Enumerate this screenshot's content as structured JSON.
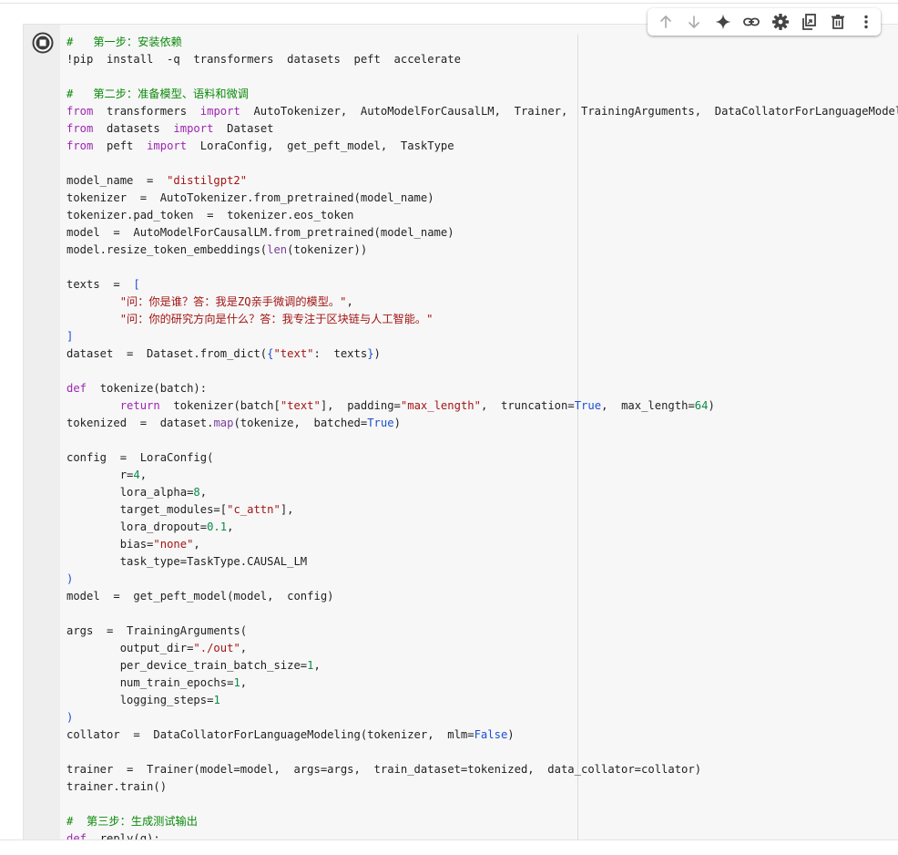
{
  "toolbar": {
    "icons": [
      "arrow-up-icon",
      "arrow-down-icon",
      "sparkle-icon",
      "link-icon",
      "gear-icon",
      "mirror-cell-icon",
      "trash-icon",
      "more-vert-icon"
    ]
  },
  "cell": {
    "run_icon": "run-cell-icon",
    "code_lines": [
      [
        [
          "cm",
          "#   第一步：安装依赖"
        ]
      ],
      [
        [
          "op",
          "!pip  install  -q  transformers  datasets  peft  accelerate"
        ]
      ],
      [],
      [
        [
          "cm",
          "#   第二步：准备模型、语料和微调"
        ]
      ],
      [
        [
          "kw",
          "from"
        ],
        [
          "op",
          "  transformers  "
        ],
        [
          "kw",
          "import"
        ],
        [
          "op",
          "  AutoTokenizer,  AutoModelForCausalLM,  Trainer,  TrainingArguments,  DataCollatorForLanguageModeling"
        ]
      ],
      [
        [
          "kw",
          "from"
        ],
        [
          "op",
          "  datasets  "
        ],
        [
          "kw",
          "import"
        ],
        [
          "op",
          "  Dataset"
        ]
      ],
      [
        [
          "kw",
          "from"
        ],
        [
          "op",
          "  peft  "
        ],
        [
          "kw",
          "import"
        ],
        [
          "op",
          "  LoraConfig,  get_peft_model,  TaskType"
        ]
      ],
      [],
      [
        [
          "op",
          "model_name  =  "
        ],
        [
          "str",
          "\"distilgpt2\""
        ]
      ],
      [
        [
          "op",
          "tokenizer  =  AutoTokenizer.from_pretrained(model_name)"
        ]
      ],
      [
        [
          "op",
          "tokenizer.pad_token  =  tokenizer.eos_token"
        ]
      ],
      [
        [
          "op",
          "model  =  AutoModelForCausalLM.from_pretrained(model_name)"
        ]
      ],
      [
        [
          "op",
          "model.resize_token_embeddings("
        ],
        [
          "bi",
          "len"
        ],
        [
          "op",
          "(tokenizer))"
        ]
      ],
      [],
      [
        [
          "op",
          "texts  =  "
        ],
        [
          "br",
          "["
        ]
      ],
      [
        [
          "op",
          "        "
        ],
        [
          "str",
          "\"问：你是谁？答：我是ZQ亲手微调的模型。\""
        ],
        [
          "op",
          ","
        ]
      ],
      [
        [
          "op",
          "        "
        ],
        [
          "str",
          "\"问：你的研究方向是什么？答：我专注于区块链与人工智能。\""
        ]
      ],
      [
        [
          "br",
          "]"
        ]
      ],
      [
        [
          "op",
          "dataset  =  Dataset.from_dict("
        ],
        [
          "br",
          "{"
        ],
        [
          "str",
          "\"text\""
        ],
        [
          "op",
          ":  texts"
        ],
        [
          "br",
          "}"
        ],
        [
          "op",
          ")"
        ]
      ],
      [],
      [
        [
          "kw",
          "def"
        ],
        [
          "op",
          "  tokenize(batch):"
        ]
      ],
      [
        [
          "op",
          "        "
        ],
        [
          "kw",
          "return"
        ],
        [
          "op",
          "  tokenizer(batch["
        ],
        [
          "str",
          "\"text\""
        ],
        [
          "op",
          "],  padding="
        ],
        [
          "str",
          "\"max_length\""
        ],
        [
          "op",
          ",  truncation="
        ],
        [
          "con",
          "True"
        ],
        [
          "op",
          ",  max_length="
        ],
        [
          "num",
          "64"
        ],
        [
          "op",
          ")"
        ]
      ],
      [
        [
          "op",
          "tokenized  =  dataset."
        ],
        [
          "bi",
          "map"
        ],
        [
          "op",
          "(tokenize,  batched="
        ],
        [
          "con",
          "True"
        ],
        [
          "op",
          ")"
        ]
      ],
      [],
      [
        [
          "op",
          "config  =  LoraConfig("
        ]
      ],
      [
        [
          "op",
          "        r="
        ],
        [
          "num",
          "4"
        ],
        [
          "op",
          ","
        ]
      ],
      [
        [
          "op",
          "        lora_alpha="
        ],
        [
          "num",
          "8"
        ],
        [
          "op",
          ","
        ]
      ],
      [
        [
          "op",
          "        target_modules=["
        ],
        [
          "str",
          "\"c_attn\""
        ],
        [
          "op",
          "],"
        ]
      ],
      [
        [
          "op",
          "        lora_dropout="
        ],
        [
          "num",
          "0.1"
        ],
        [
          "op",
          ","
        ]
      ],
      [
        [
          "op",
          "        bias="
        ],
        [
          "str",
          "\"none\""
        ],
        [
          "op",
          ","
        ]
      ],
      [
        [
          "op",
          "        task_type=TaskType.CAUSAL_LM"
        ]
      ],
      [
        [
          "br",
          ")"
        ]
      ],
      [
        [
          "op",
          "model  =  get_peft_model(model,  config)"
        ]
      ],
      [],
      [
        [
          "op",
          "args  =  TrainingArguments("
        ]
      ],
      [
        [
          "op",
          "        output_dir="
        ],
        [
          "str",
          "\"./out\""
        ],
        [
          "op",
          ","
        ]
      ],
      [
        [
          "op",
          "        per_device_train_batch_size="
        ],
        [
          "num",
          "1"
        ],
        [
          "op",
          ","
        ]
      ],
      [
        [
          "op",
          "        num_train_epochs="
        ],
        [
          "num",
          "1"
        ],
        [
          "op",
          ","
        ]
      ],
      [
        [
          "op",
          "        logging_steps="
        ],
        [
          "num",
          "1"
        ]
      ],
      [
        [
          "br",
          ")"
        ]
      ],
      [
        [
          "op",
          "collator  =  DataCollatorForLanguageModeling(tokenizer,  mlm="
        ],
        [
          "con",
          "False"
        ],
        [
          "op",
          ")"
        ]
      ],
      [],
      [
        [
          "op",
          "trainer  =  Trainer(model=model,  args=args,  train_dataset=tokenized,  data_collator=collator)"
        ]
      ],
      [
        [
          "op",
          "trainer.train()"
        ]
      ],
      [],
      [
        [
          "cm",
          "#  第三步：生成测试输出"
        ]
      ],
      [
        [
          "kw",
          "def"
        ],
        [
          "op",
          "  reply(q):"
        ]
      ]
    ]
  }
}
